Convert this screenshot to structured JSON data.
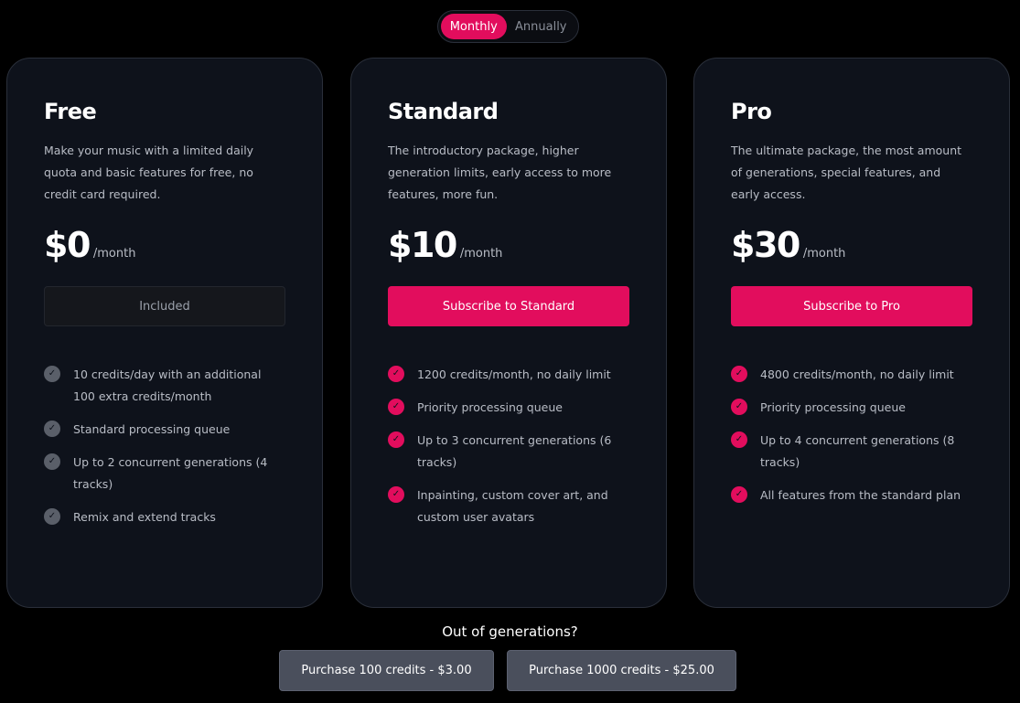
{
  "billing_toggle": {
    "monthly": "Monthly",
    "annually": "Annually"
  },
  "colors": {
    "accent": "#e20d5d",
    "card_bg": "#0e121b",
    "page_bg": "#000000",
    "muted_check": "#5a5f69"
  },
  "plans": [
    {
      "name": "Free",
      "description": "Make your music with a limited daily quota and basic features for free, no credit card required.",
      "price": "$0",
      "period": "/month",
      "cta": "Included",
      "features": [
        "10 credits/day with an additional 100 extra credits/month",
        "Standard processing queue",
        "Up to 2 concurrent generations (4 tracks)",
        "Remix and extend tracks"
      ]
    },
    {
      "name": "Standard",
      "description": "The introductory package, higher generation limits, early access to more features, more fun.",
      "price": "$10",
      "period": "/month",
      "cta": "Subscribe to Standard",
      "features": [
        "1200 credits/month, no daily limit",
        "Priority processing queue",
        "Up to 3 concurrent generations (6 tracks)",
        "Inpainting, custom cover art, and custom user avatars"
      ]
    },
    {
      "name": "Pro",
      "description": "The ultimate package, the most amount of generations, special features, and early access.",
      "price": "$30",
      "period": "/month",
      "cta": "Subscribe to Pro",
      "features": [
        "4800 credits/month, no daily limit",
        "Priority processing queue",
        "Up to 4 concurrent generations (8 tracks)",
        "All features from the standard plan"
      ]
    }
  ],
  "extras": {
    "title": "Out of generations?",
    "buy_100": "Purchase 100 credits - $3.00",
    "buy_1000": "Purchase 1000 credits - $25.00"
  }
}
